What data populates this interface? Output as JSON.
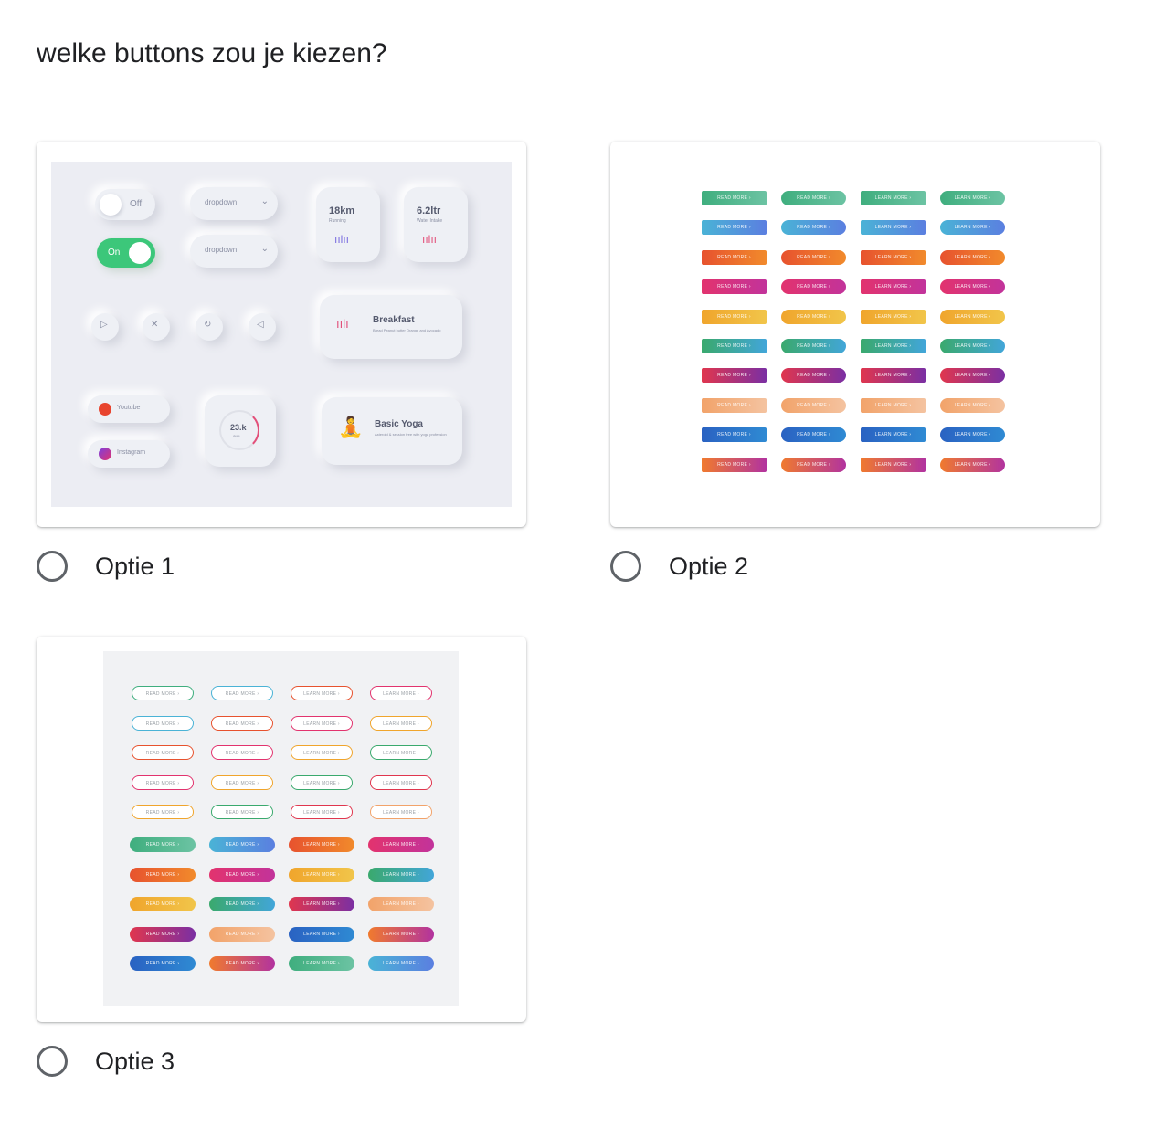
{
  "question": "welke buttons zou je kiezen?",
  "options": [
    {
      "label": "Optie 1"
    },
    {
      "label": "Optie 2"
    },
    {
      "label": "Optie 3"
    }
  ],
  "neumorph": {
    "toggle_off": "Off",
    "toggle_on": "On",
    "dropdown": "dropdown",
    "stat1_value": "18km",
    "stat1_label": "Running",
    "stat2_value": "6.2ltr",
    "stat2_label": "Water Intake",
    "breakfast_title": "Breakfast",
    "breakfast_sub": "Bread Peanut butter Orange and Avocado",
    "youtube": "Youtube",
    "instagram": "Instagram",
    "dial_value": "23.k",
    "dial_label": "views",
    "yoga_title": "Basic Yoga",
    "yoga_sub": "Asteroid & session free with yoga profession",
    "colors": {
      "background": "#ecedf3",
      "toggle_on": "#3cc77a"
    }
  },
  "button_grid": {
    "read_more": "READ MORE",
    "learn_more": "LEARN MORE",
    "gradients": [
      [
        "#3fae7e",
        "#6cc3a3"
      ],
      [
        "#4ab3d6",
        "#5b7fe0"
      ],
      [
        "#e7522e",
        "#f18a2c"
      ],
      [
        "#e2336e",
        "#c2339b"
      ],
      [
        "#f0a52c",
        "#f1c54a"
      ],
      [
        "#3aa96d",
        "#42a6d9"
      ],
      [
        "#e0364e",
        "#7b2fa3"
      ],
      [
        "#f2a36a",
        "#f4c3a0"
      ],
      [
        "#2a62c2",
        "#2f8ad3"
      ],
      [
        "#f07a2e",
        "#b2339f"
      ]
    ]
  }
}
